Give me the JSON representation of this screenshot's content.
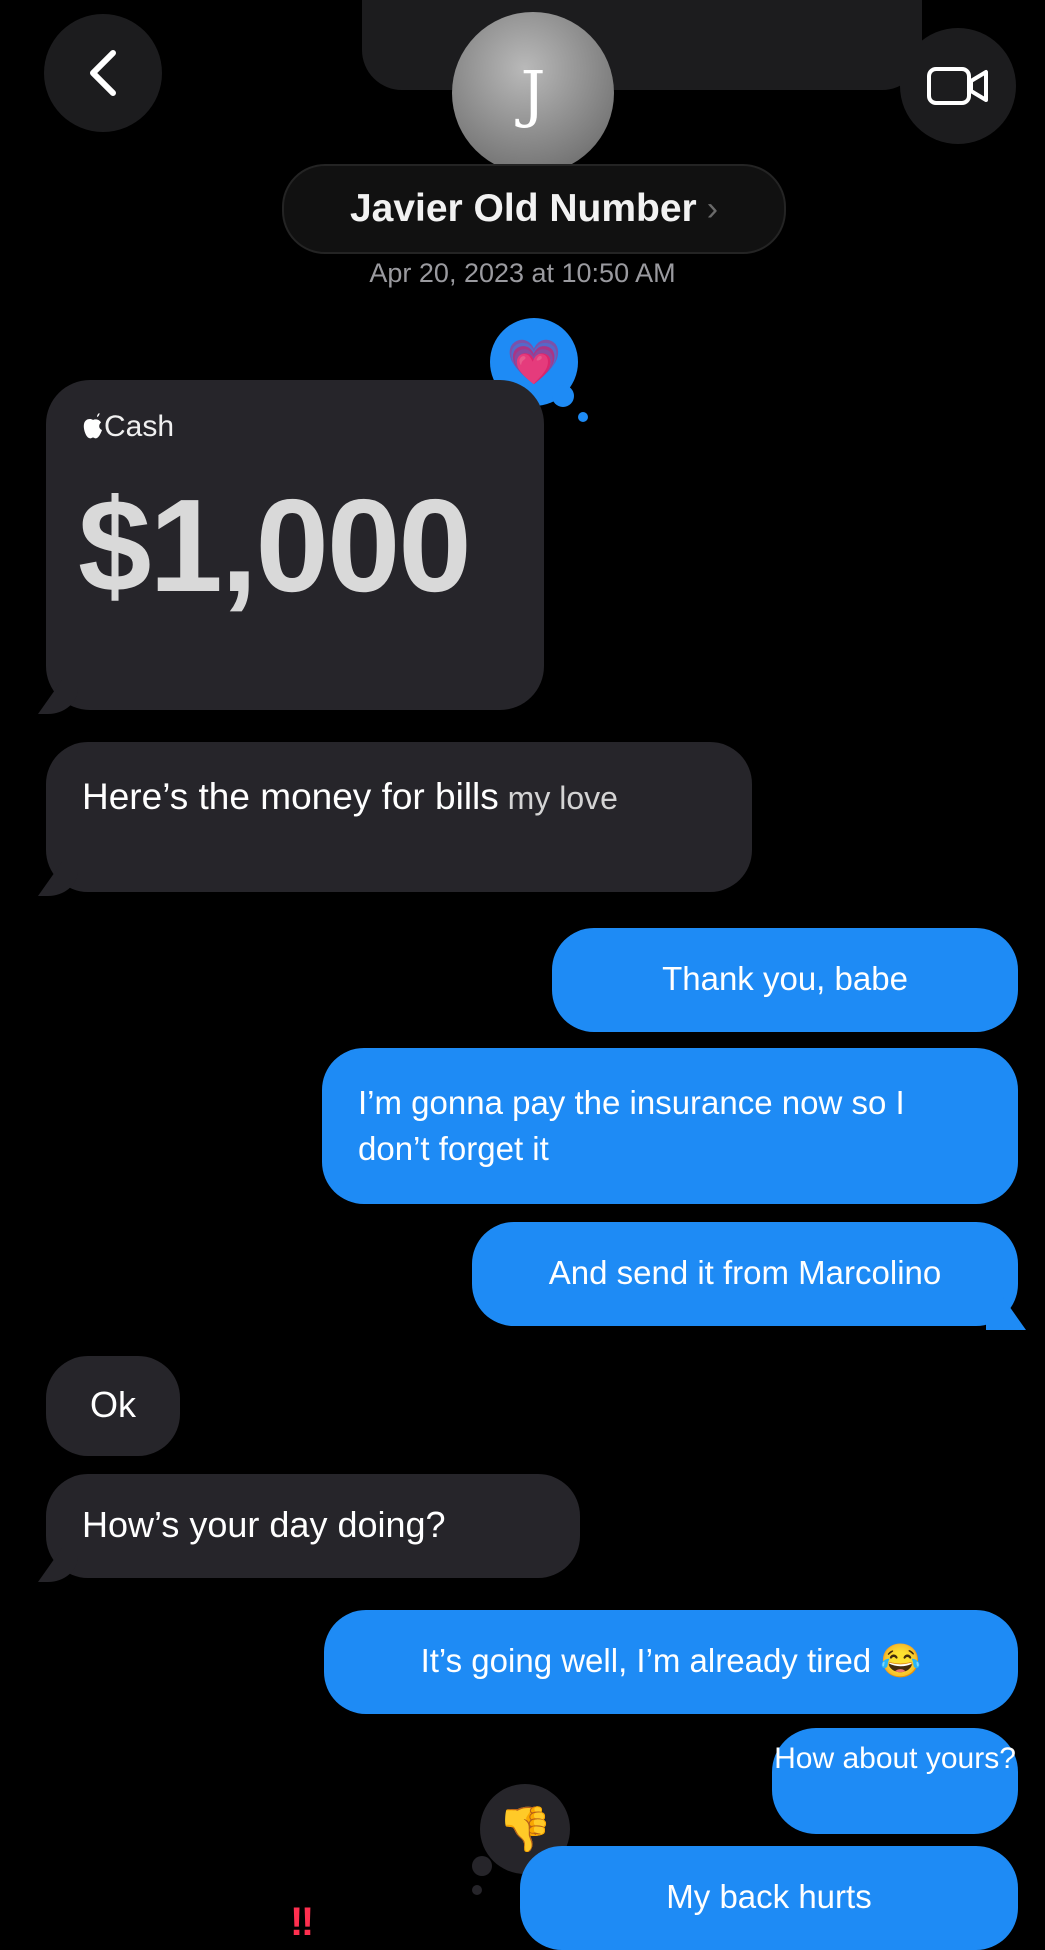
{
  "header": {
    "contact_initial": "J",
    "contact_name": "Javier Old Number",
    "chevron": "›",
    "timestamp": "Apr 20, 2023 at 10:50 AM"
  },
  "icons": {
    "back": "chevron-left-icon",
    "video": "video-camera-icon"
  },
  "reactions": {
    "heart": "💗",
    "thumbs_down": "👎",
    "partial": "‼"
  },
  "cash_card": {
    "label": "Cash",
    "amount": "$1,000"
  },
  "messages": [
    {
      "side": "received",
      "text_main": "Here’s the money for bills",
      "text_extra": " my love"
    },
    {
      "side": "sent",
      "text": "Thank you, babe"
    },
    {
      "side": "sent",
      "text": "I’m gonna pay the insurance now so I don’t forget it"
    },
    {
      "side": "sent",
      "text": "And send it from Marcolino"
    },
    {
      "side": "received",
      "text": "Ok"
    },
    {
      "side": "received",
      "text": "How’s your day doing?"
    },
    {
      "side": "sent",
      "text": "It’s going well, I’m already tired 😂"
    },
    {
      "side": "sent",
      "text": "How about yours?"
    },
    {
      "side": "sent",
      "text": "My back hurts"
    }
  ],
  "colors": {
    "background": "#000000",
    "received_bubble": "#26252a",
    "sent_bubble": "#1e8bf5"
  }
}
